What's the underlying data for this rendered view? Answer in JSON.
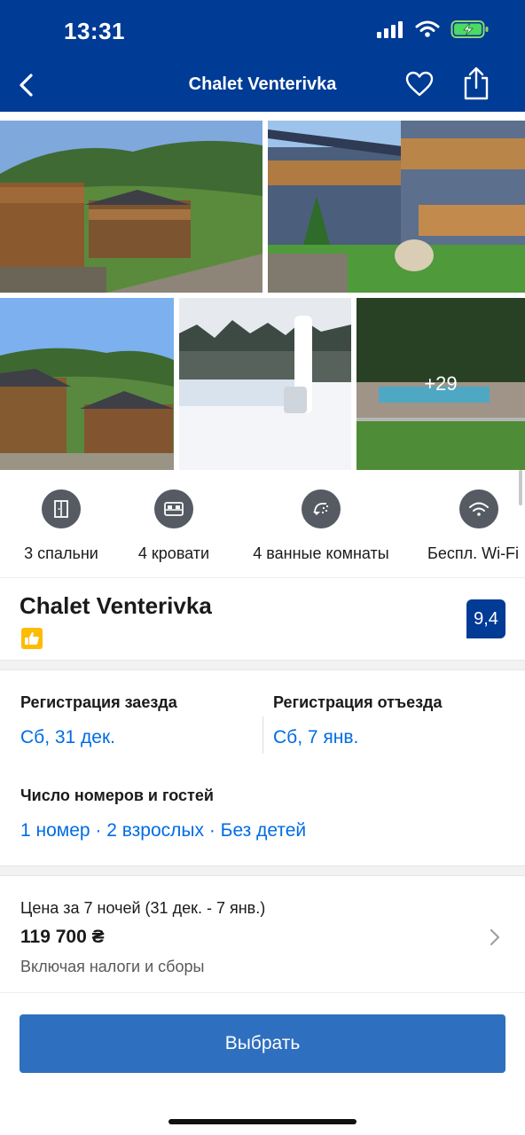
{
  "status_bar": {
    "time": "13:31"
  },
  "nav": {
    "title": "Chalet Venterivka",
    "back_icon": "chevron-left-icon",
    "favorite_icon": "heart-icon",
    "share_icon": "share-icon"
  },
  "gallery": {
    "more_count": "+29"
  },
  "amenities": [
    {
      "label": "3 спальни",
      "icon": "door-icon"
    },
    {
      "label": "4 кровати",
      "icon": "bed-icon"
    },
    {
      "label": "4 ванные комнаты",
      "icon": "shower-icon"
    },
    {
      "label": "Беспл. Wi-Fi",
      "icon": "wifi-icon"
    }
  ],
  "property": {
    "name": "Chalet Venterivka",
    "score": "9,4",
    "badge_icon": "thumbs-up-icon"
  },
  "dates": {
    "checkin_label": "Регистрация заезда",
    "checkin_value": "Сб, 31 дек.",
    "checkout_label": "Регистрация отъезда",
    "checkout_value": "Сб, 7 янв.",
    "guests_label": "Число номеров и гостей",
    "guests_value": "1 номер · 2 взрослых · Без детей"
  },
  "price": {
    "label": "Цена за 7 ночей (31 дек. - 7 янв.)",
    "amount": "119 700 ₴",
    "note": "Включая налоги и сборы"
  },
  "cta": {
    "label": "Выбрать"
  },
  "colors": {
    "header": "#003b95",
    "link": "#006ce4",
    "button": "#2f6fbf",
    "badge": "#febb02"
  }
}
